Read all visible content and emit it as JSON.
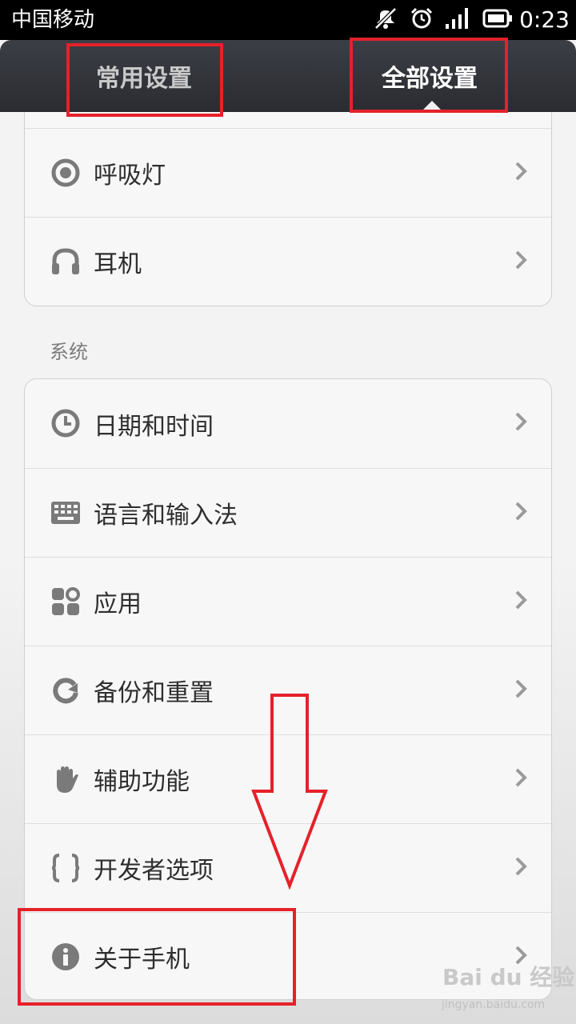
{
  "status_bar": {
    "carrier": "中国移动",
    "time": "0:23",
    "icons": [
      "mute-icon",
      "alarm-icon",
      "signal-icon",
      "battery-icon"
    ]
  },
  "tabs": [
    {
      "label": "常用设置",
      "selected": false
    },
    {
      "label": "全部设置",
      "selected": true
    }
  ],
  "top_group": {
    "items": [
      {
        "label": "呼吸灯",
        "icon": "notification-light-icon"
      },
      {
        "label": "耳机",
        "icon": "headphones-icon"
      }
    ]
  },
  "system_section": {
    "title": "系统",
    "items": [
      {
        "label": "日期和时间",
        "icon": "clock-icon"
      },
      {
        "label": "语言和输入法",
        "icon": "keyboard-icon"
      },
      {
        "label": "应用",
        "icon": "apps-icon"
      },
      {
        "label": "备份和重置",
        "icon": "backup-icon"
      },
      {
        "label": "辅助功能",
        "icon": "hand-icon"
      },
      {
        "label": "开发者选项",
        "icon": "braces-icon"
      },
      {
        "label": "关于手机",
        "icon": "info-icon"
      }
    ]
  },
  "watermark": {
    "logo": "Bai du 经验",
    "url": "jingyan.baidu.com"
  },
  "colors": {
    "highlight": "#e5212a",
    "tab_bar": "#2f3136",
    "icon_gray": "#7a7a7a"
  }
}
